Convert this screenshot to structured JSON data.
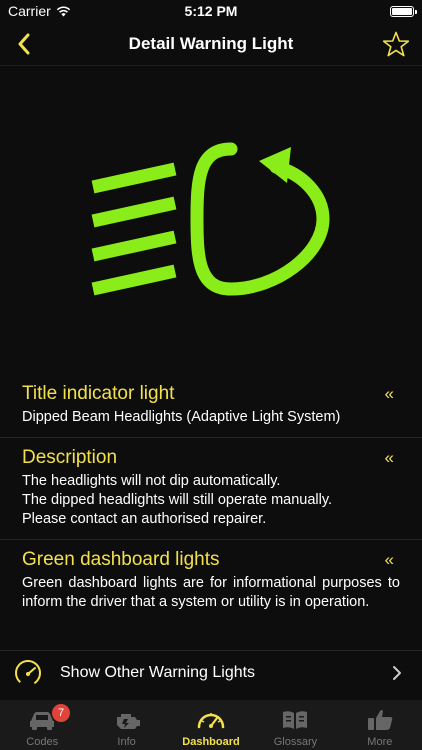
{
  "status_bar": {
    "carrier": "Carrier",
    "time": "5:12 PM"
  },
  "nav": {
    "title": "Detail Warning Light"
  },
  "colors": {
    "accent": "#f2e14c",
    "symbol_green": "#8aed1a",
    "badge_red": "#e0433a",
    "background": "#0d0d0d"
  },
  "sections": [
    {
      "title": "Title indicator light",
      "collapse": "«",
      "body": "Dipped Beam Headlights (Adaptive Light System)"
    },
    {
      "title": "Description",
      "collapse": "«",
      "body": "The headlights will not dip automatically.\nThe dipped headlights will still operate manually.\nPlease contact an authorised repairer."
    },
    {
      "title": "Green dashboard lights",
      "collapse": "«",
      "body": "Green dashboard lights are for informational purposes to inform the driver that a system or utility is in operation."
    }
  ],
  "other_warnings": {
    "label": "Show Other Warning Lights"
  },
  "tabs": [
    {
      "label": "Codes",
      "badge": "7",
      "icon": "car-warning-icon"
    },
    {
      "label": "Info",
      "icon": "engine-icon"
    },
    {
      "label": "Dashboard",
      "icon": "speedometer-icon"
    },
    {
      "label": "Glossary",
      "icon": "book-icon"
    },
    {
      "label": "More",
      "icon": "thumbs-up-icon"
    }
  ]
}
